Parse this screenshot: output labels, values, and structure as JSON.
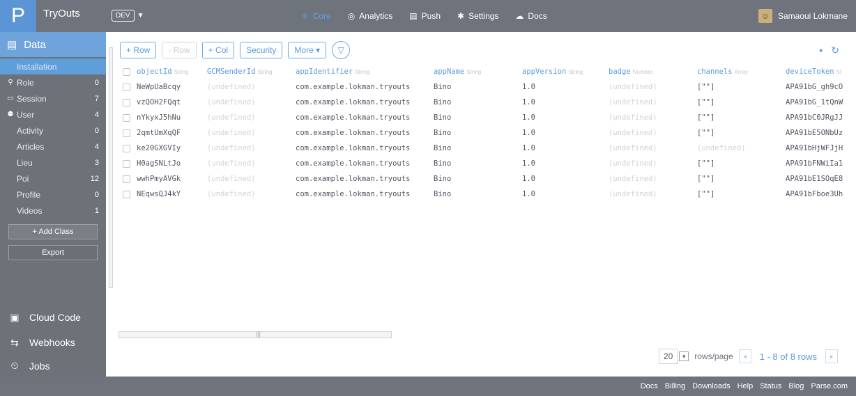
{
  "app": {
    "logo": "P",
    "name": "TryOuts",
    "env": "DEV",
    "env_caret": "▼"
  },
  "topnav": [
    {
      "label": "Core",
      "icon": "⚛",
      "active": true
    },
    {
      "label": "Analytics",
      "icon": "◎"
    },
    {
      "label": "Push",
      "icon": "▤"
    },
    {
      "label": "Settings",
      "icon": "✱"
    },
    {
      "label": "Docs",
      "icon": "☁"
    }
  ],
  "user": {
    "name": "Samaoui Lokmane",
    "avatar": "☺"
  },
  "sidebar": {
    "head": {
      "icon": "▤",
      "label": "Data"
    },
    "classes": [
      {
        "label": "Installation",
        "count": "",
        "icon": "",
        "active": true
      },
      {
        "label": "Role",
        "count": "0",
        "icon": "⚲"
      },
      {
        "label": "Session",
        "count": "7",
        "icon": "▭"
      },
      {
        "label": "User",
        "count": "4",
        "icon": "⚉"
      },
      {
        "label": "Activity",
        "count": "0",
        "icon": ""
      },
      {
        "label": "Articles",
        "count": "4",
        "icon": ""
      },
      {
        "label": "Lieu",
        "count": "3",
        "icon": ""
      },
      {
        "label": "Poi",
        "count": "12",
        "icon": ""
      },
      {
        "label": "Profile",
        "count": "0",
        "icon": ""
      },
      {
        "label": "Videos",
        "count": "1",
        "icon": ""
      }
    ],
    "add_class": "+ Add Class",
    "export": "Export",
    "sections": {
      "cloud": {
        "label": "Cloud Code",
        "icon": "▣"
      },
      "hooks": {
        "label": "Webhooks",
        "icon": "⇆"
      },
      "jobs": {
        "label": "Jobs",
        "icon": "⏲"
      }
    }
  },
  "toolbar": {
    "add_row": "+ Row",
    "del_row": "- Row",
    "add_col": "+ Col",
    "security": "Security",
    "more": "More ▾",
    "filter_icon": "▽",
    "refresh_icons": [
      "▪",
      "↻"
    ]
  },
  "table": {
    "columns": [
      {
        "name": "objectId",
        "type": "String"
      },
      {
        "name": "GCMSenderId",
        "type": "String"
      },
      {
        "name": "appIdentifier",
        "type": "String"
      },
      {
        "name": "appName",
        "type": "String"
      },
      {
        "name": "appVersion",
        "type": "String"
      },
      {
        "name": "badge",
        "type": "Number"
      },
      {
        "name": "channels",
        "type": "Array"
      },
      {
        "name": "deviceToken",
        "type": "St"
      }
    ],
    "rows": [
      [
        "NeWpUaBcqy",
        "(undefined)",
        "com.example.lokman.tryouts",
        "Bino",
        "1.0",
        "(undefined)",
        "[\"\"]",
        "APA91bG_gh9cO"
      ],
      [
        "vzQOH2FQqt",
        "(undefined)",
        "com.example.lokman.tryouts",
        "Bino",
        "1.0",
        "(undefined)",
        "[\"\"]",
        "APA91bG_1tQnW"
      ],
      [
        "nYkyxJ5hNu",
        "(undefined)",
        "com.example.lokman.tryouts",
        "Bino",
        "1.0",
        "(undefined)",
        "[\"\"]",
        "APA91bC0JRgJJ"
      ],
      [
        "2qmtUmXqQF",
        "(undefined)",
        "com.example.lokman.tryouts",
        "Bino",
        "1.0",
        "(undefined)",
        "[\"\"]",
        "APA91bE5ONbUz"
      ],
      [
        "ke20GXGVIy",
        "(undefined)",
        "com.example.lokman.tryouts",
        "Bino",
        "1.0",
        "(undefined)",
        "(undefined)",
        "APA91bHjWFJjH"
      ],
      [
        "H0agSNLtJo",
        "(undefined)",
        "com.example.lokman.tryouts",
        "Bino",
        "1.0",
        "(undefined)",
        "[\"\"]",
        "APA91bFNWiIa1"
      ],
      [
        "wwhPmyAVGk",
        "(undefined)",
        "com.example.lokman.tryouts",
        "Bino",
        "1.0",
        "(undefined)",
        "[\"\"]",
        "APA91bE1SOqE8"
      ],
      [
        "NEqwsQJ4kY",
        "(undefined)",
        "com.example.lokman.tryouts",
        "Bino",
        "1.0",
        "(undefined)",
        "[\"\"]",
        "APA91bFboe3Uh"
      ]
    ]
  },
  "pager": {
    "rows_per_page": "20",
    "rows_label": "rows/page",
    "prev": "◂",
    "next": "▸",
    "range": "1 - 8 of 8 rows"
  },
  "footer": [
    "Docs",
    "Billing",
    "Downloads",
    "Help",
    "Status",
    "Blog",
    "Parse.com"
  ]
}
